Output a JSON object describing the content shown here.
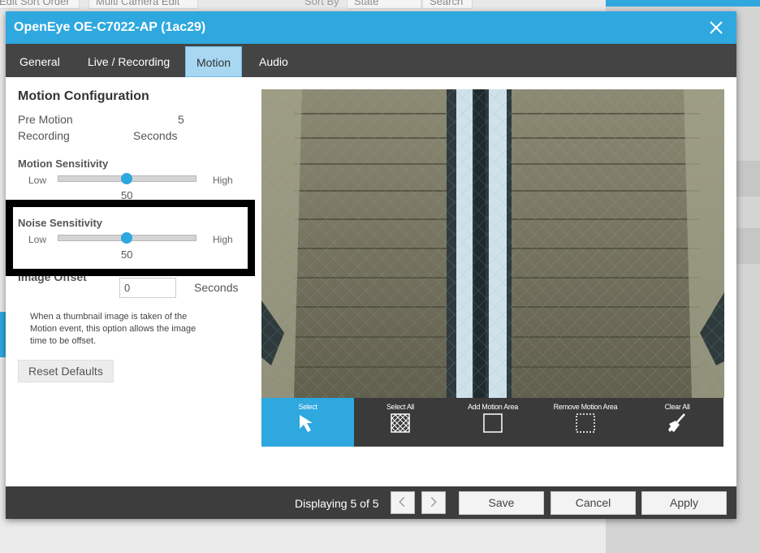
{
  "background": {
    "buttons": [
      "Edit Sort Order",
      "Multi Camera Edit"
    ],
    "sort_by_label": "Sort By",
    "sort_value": "State",
    "search_label": "Search"
  },
  "dialog": {
    "title": "OpenEye OE-C7022-AP (1ac29)",
    "tabs": [
      {
        "label": "General",
        "active": false
      },
      {
        "label": "Live / Recording",
        "active": false
      },
      {
        "label": "Motion",
        "active": true
      },
      {
        "label": "Audio",
        "active": false
      }
    ]
  },
  "motion_config": {
    "heading": "Motion Configuration",
    "pre_motion_label_1": "Pre Motion",
    "pre_motion_label_2": "Recording",
    "pre_motion_value": "5",
    "pre_motion_unit": "Seconds",
    "motion_sensitivity": {
      "label": "Motion Sensitivity",
      "low": "Low",
      "high": "High",
      "value": "50",
      "level": 0.5
    },
    "noise_sensitivity": {
      "label": "Noise Sensitivity",
      "low": "Low",
      "high": "High",
      "value": "50",
      "level": 0.5
    },
    "image_offset": {
      "label": "Image Offset",
      "value": "0",
      "unit": "Seconds"
    },
    "note": "When a thumbnail image is taken of the Motion event, this option allows the image time to be offset.",
    "reset_label": "Reset Defaults"
  },
  "tools": [
    {
      "label": "Select",
      "icon": "cursor-arrow-icon",
      "active": true
    },
    {
      "label": "Select All",
      "icon": "crosshatch-grid-icon",
      "active": false
    },
    {
      "label": "Add Motion Area",
      "icon": "square-outline-icon",
      "active": false
    },
    {
      "label": "Remove Motion Area",
      "icon": "dashed-square-icon",
      "active": false
    },
    {
      "label": "Clear All",
      "icon": "broom-icon",
      "active": false
    }
  ],
  "footer": {
    "display_text": "Displaying 5 of 5",
    "save_label": "Save",
    "cancel_label": "Cancel",
    "apply_label": "Apply"
  },
  "colors": {
    "accent": "#2ea8df",
    "tab_active": "#a7d7f1",
    "dark_bar": "#444444",
    "footer": "#3d3d3d"
  }
}
